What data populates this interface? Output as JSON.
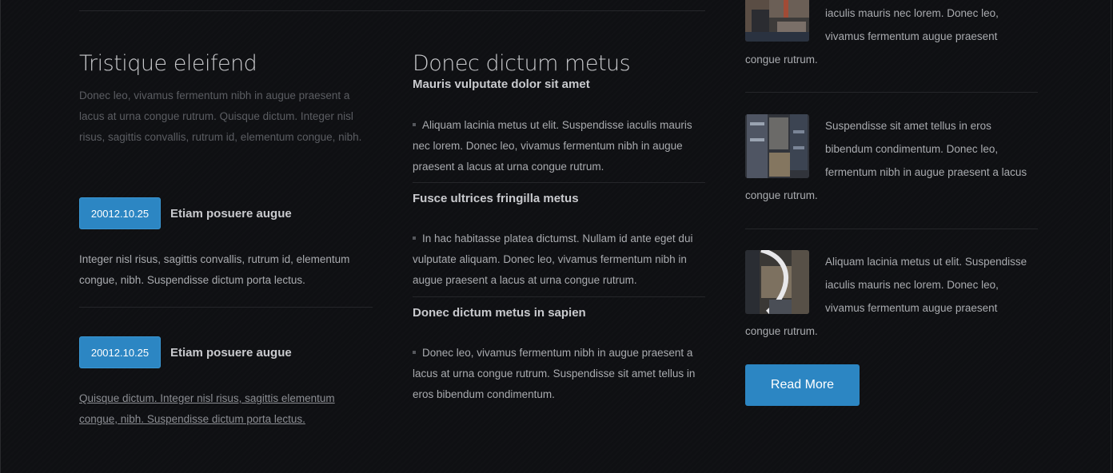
{
  "col1": {
    "title": "Tristique eleifend",
    "intro": "Donec leo, vivamus fermentum nibh in augue praesent a lacus at urna congue rutrum. Quisque dictum. Integer nisl risus, sagittis convallis, rutrum id, elementum congue, nibh.",
    "posts": [
      {
        "date": "20012.10.25",
        "title": "Etiam posuere augue",
        "text": "Integer nisl risus, sagittis convallis, rutrum id, elementum congue, nibh. Suspendisse dictum porta lectus."
      },
      {
        "date": "20012.10.25",
        "title": "Etiam posuere augue",
        "text": "Quisque dictum. Integer nisl risus, sagittis elementum congue, nibh. Suspendisse dictum porta lectus."
      }
    ]
  },
  "col2": {
    "title": "Donec dictum metus",
    "items": [
      {
        "heading": "Mauris vulputate dolor sit amet",
        "text": "Aliquam lacinia metus ut elit. Suspendisse iaculis mauris nec lorem. Donec leo, vivamus fermentum nibh in augue praesent a lacus at urna congue rutrum."
      },
      {
        "heading": "Fusce ultrices fringilla metus",
        "text": "In hac habitasse platea dictumst. Nullam id ante eget dui vulputate aliquam. Donec leo, vivamus fermentum nibh in augue praesent a lacus at urna congue rutrum."
      },
      {
        "heading": "Donec dictum metus in sapien",
        "text": "Donec leo, vivamus fermentum nibh in augue praesent a lacus at urna congue rutrum. Suspendisse sit amet tellus in eros bibendum condimentum."
      }
    ]
  },
  "col3": {
    "items": [
      {
        "lines": [
          "iaculis mauris nec lorem. Donec leo,",
          "vivamus fermentum augue praesent",
          "congue rutrum."
        ]
      },
      {
        "lines": [
          "Suspendisse sit amet tellus in eros",
          "bibendum condimentum. Donec leo,",
          "fermentum nibh in augue praesent a lacus",
          "congue rutrum."
        ]
      },
      {
        "lines": [
          "Aliquam lacinia metus ut elit. Suspendisse",
          "iaculis mauris nec lorem. Donec leo,",
          "vivamus fermentum augue praesent",
          "congue rutrum."
        ]
      }
    ],
    "read_more_label": "Read More"
  },
  "colors": {
    "accent": "#2c86c3",
    "background": "#0f1013",
    "heading": "#c8c9cc",
    "body_text": "#a9abaf",
    "muted_text": "#5b5d62"
  }
}
